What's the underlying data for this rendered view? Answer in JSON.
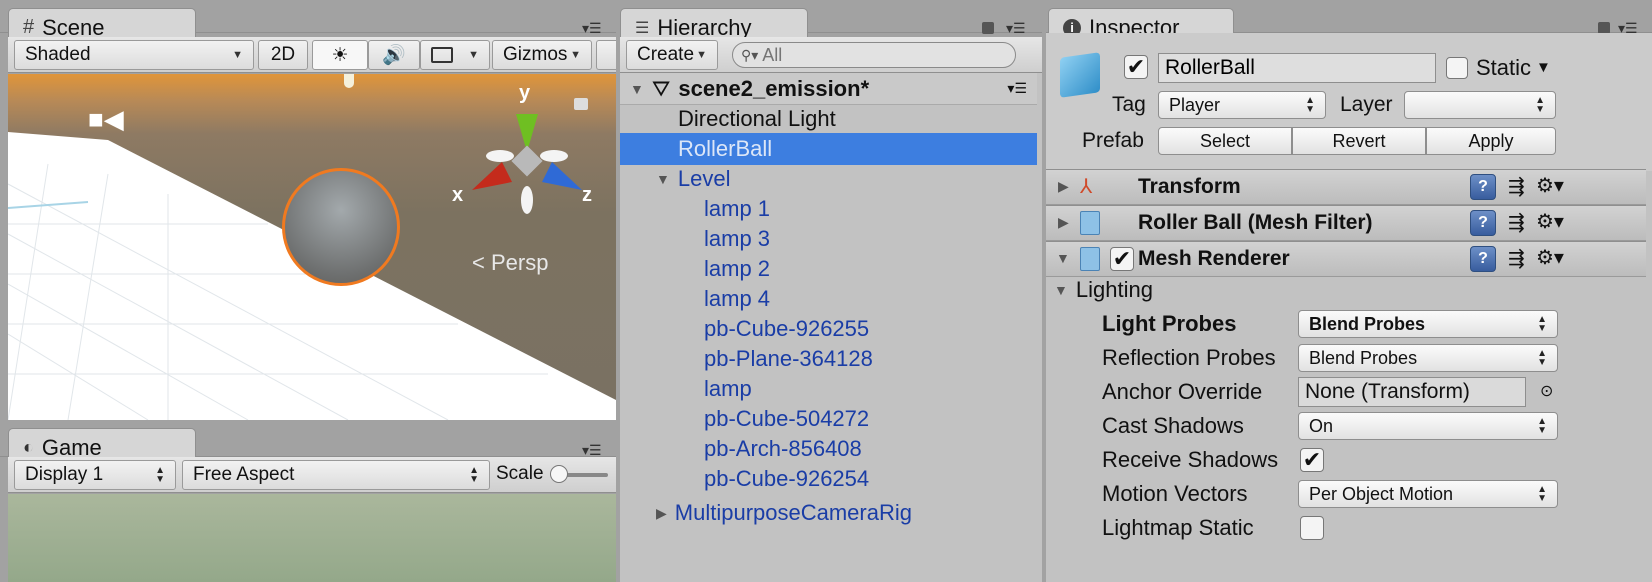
{
  "scene": {
    "tab_label": "Scene",
    "toolbar": {
      "shading": "Shaded",
      "mode_2d": "2D",
      "gizmos": "Gizmos"
    },
    "gizmo_axes": {
      "x": "x",
      "y": "y",
      "z": "z"
    },
    "projection_label": "Persp"
  },
  "game": {
    "tab_label": "Game",
    "display": "Display 1",
    "aspect": "Free Aspect",
    "scale_label": "Scale",
    "scale_value": 0.0
  },
  "hierarchy": {
    "tab_label": "Hierarchy",
    "create_label": "Create",
    "search_placeholder": "All",
    "scene_name": "scene2_emission*",
    "items": [
      {
        "label": "Directional Light"
      },
      {
        "label": "RollerBall"
      },
      {
        "label": "Level"
      },
      {
        "label": "lamp 1"
      },
      {
        "label": "lamp 3"
      },
      {
        "label": "lamp 2"
      },
      {
        "label": "lamp 4"
      },
      {
        "label": "pb-Cube-926255"
      },
      {
        "label": "pb-Plane-364128"
      },
      {
        "label": "lamp"
      },
      {
        "label": "pb-Cube-504272"
      },
      {
        "label": "pb-Arch-856408"
      },
      {
        "label": "pb-Cube-926254"
      },
      {
        "label": "MultipurposeCameraRig"
      }
    ]
  },
  "inspector": {
    "tab_label": "Inspector",
    "object_name": "RollerBall",
    "static_label": "Static",
    "tag_label": "Tag",
    "tag_value": "Player",
    "layer_label": "Layer",
    "layer_value": "",
    "prefab_label": "Prefab",
    "prefab_buttons": {
      "select": "Select",
      "revert": "Revert",
      "apply": "Apply"
    },
    "components": {
      "transform": "Transform",
      "mesh_filter": "Roller Ball (Mesh Filter)",
      "mesh_renderer": "Mesh Renderer"
    },
    "lighting": {
      "section_label": "Lighting",
      "light_probes_label": "Light Probes",
      "light_probes_value": "Blend Probes",
      "reflection_probes_label": "Reflection Probes",
      "reflection_probes_value": "Blend Probes",
      "anchor_override_label": "Anchor Override",
      "anchor_override_value": "None (Transform)",
      "cast_shadows_label": "Cast Shadows",
      "cast_shadows_value": "On",
      "receive_shadows_label": "Receive Shadows",
      "receive_shadows_checked": true,
      "motion_vectors_label": "Motion Vectors",
      "motion_vectors_value": "Per Object Motion",
      "lightmap_static_label": "Lightmap Static",
      "lightmap_static_checked": false
    }
  },
  "colors": {
    "selection": "#3d7ee0",
    "hierarchy_prefab_text": "#1a3da6",
    "sphere_outline": "#f07a20"
  }
}
